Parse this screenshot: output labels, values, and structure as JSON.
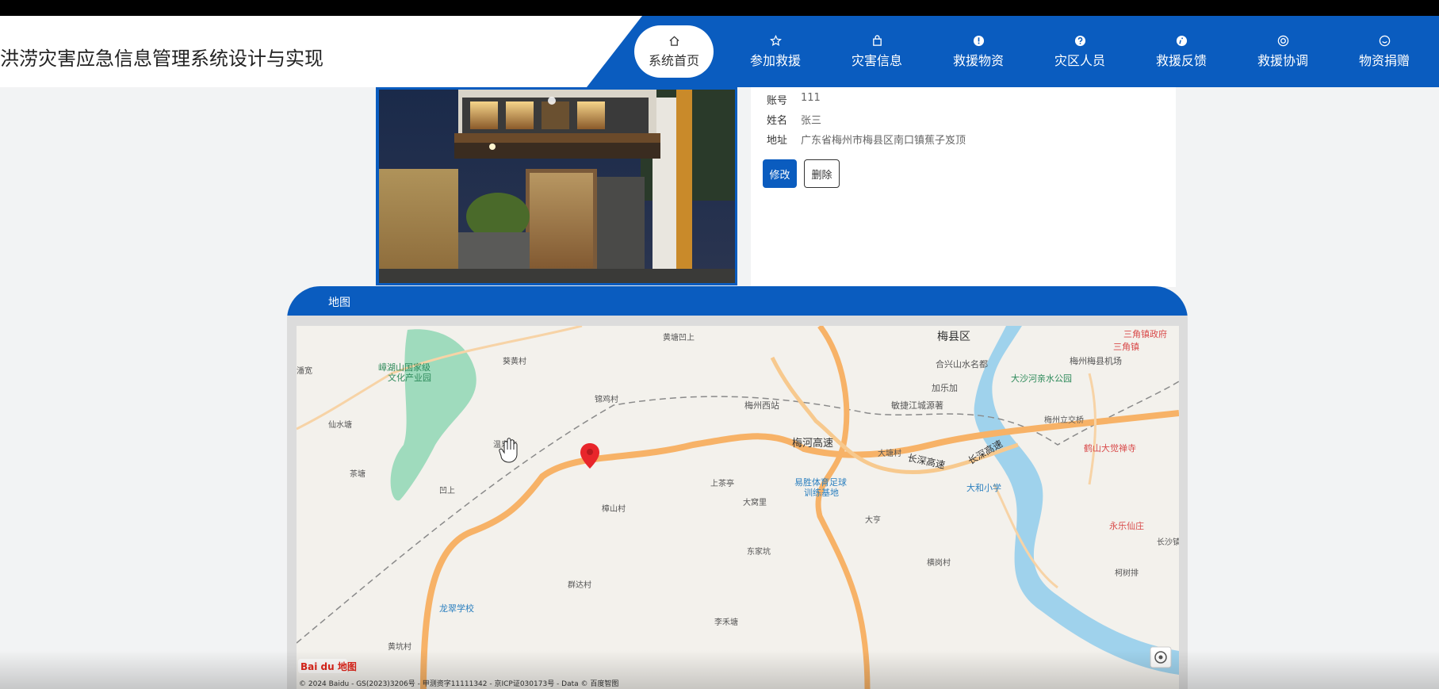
{
  "header": {
    "title": "洪涝灾害应急信息管理系统设计与实现"
  },
  "nav": {
    "items": [
      {
        "label": "系统首页",
        "icon": "home-icon"
      },
      {
        "label": "参加救援",
        "icon": "star-icon"
      },
      {
        "label": "灾害信息",
        "icon": "bag-icon"
      },
      {
        "label": "救援物资",
        "icon": "alert-icon"
      },
      {
        "label": "灾区人员",
        "icon": "help-icon"
      },
      {
        "label": "救援反馈",
        "icon": "info-icon"
      },
      {
        "label": "救援协调",
        "icon": "lifebuoy-icon"
      },
      {
        "label": "物资捐赠",
        "icon": "smile-icon"
      }
    ]
  },
  "detail": {
    "account_label": "账号",
    "account_value": "111",
    "name_label": "姓名",
    "name_value": "张三",
    "address_label": "地址",
    "address_value": "广东省梅州市梅县区南口镇蕉子岌顶",
    "edit_label": "修改",
    "delete_label": "删除"
  },
  "map": {
    "title": "地图",
    "places": {
      "meixian": "梅县区",
      "sanjiao_gov": "三角镇政府",
      "sanjiao": "三角镇",
      "airport": "梅州梅县机场",
      "huangtang": "黄塘凹上",
      "heshan": "合兴山水名都",
      "dasha_park": "大沙河亲水公园",
      "jialejia": "加乐加",
      "mingshan": "嶂湖山国家级",
      "mingshan2": "文化产业园",
      "xiwang": "葵黄村",
      "jinan": "锦鸡村",
      "xianshui": "仙水塘",
      "meizhou_west": "梅州西站",
      "jingjiang": "敏捷江城源著",
      "meizhou_junction": "梅州立交桥",
      "meihe": "梅河高速",
      "changshen": "长深高速",
      "changshen2": "长深高速",
      "hexing": "鹤山大觉禅寺",
      "datang": "大塘村",
      "shangcha": "上茶亭",
      "yisheng": "易胜体育足球",
      "yisheng2": "训练基地",
      "dahe": "大和小学",
      "tangshan": "樟山村",
      "dawuli": "大窝里",
      "dapeng": "大亨",
      "yongle": "永乐仙庄",
      "changsha": "长沙镇",
      "ketiao": "柯树排",
      "dongjia": "东家坑",
      "qunda": "群达村",
      "hengyu": "横岗村",
      "longcui": "龙翠学校",
      "lihe": "李禾塘",
      "huangkeng": "黄坑村",
      "chatang": "茶塘",
      "aoshang": "凹上",
      "wenquan": "温泉坑",
      "mingyuan": "潘宽"
    },
    "copyright": "© 2024 Baidu - GS(2023)3206号 - 甲测资字11111342 - 京ICP证030173号 - Data © 百度智图",
    "logo": "Bai du 地图",
    "colors": {
      "road": "#f7b267",
      "water": "#9fd2ec",
      "park": "#9fdbbd",
      "marker": "#e8262b"
    }
  }
}
